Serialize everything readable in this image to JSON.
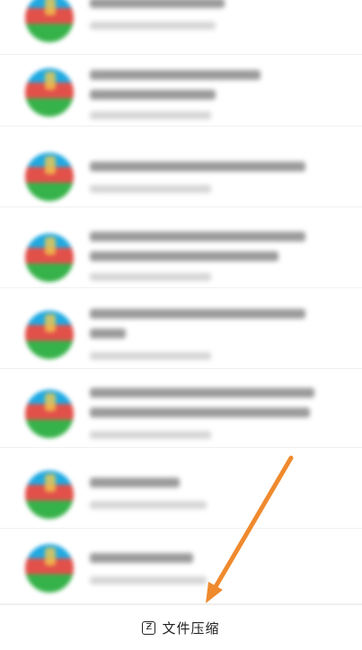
{
  "bottom_bar": {
    "compress_label": "文件压缩",
    "icon": "compress-icon"
  },
  "files": [
    {
      "icon": "zip-archive-icon"
    },
    {
      "icon": "zip-archive-icon"
    },
    {
      "icon": "zip-archive-icon"
    },
    {
      "icon": "zip-archive-icon"
    },
    {
      "icon": "zip-archive-icon"
    },
    {
      "icon": "zip-archive-icon"
    },
    {
      "icon": "zip-archive-icon"
    },
    {
      "icon": "zip-archive-icon"
    }
  ],
  "annotation": {
    "arrow_color": "#ef8a2e"
  }
}
